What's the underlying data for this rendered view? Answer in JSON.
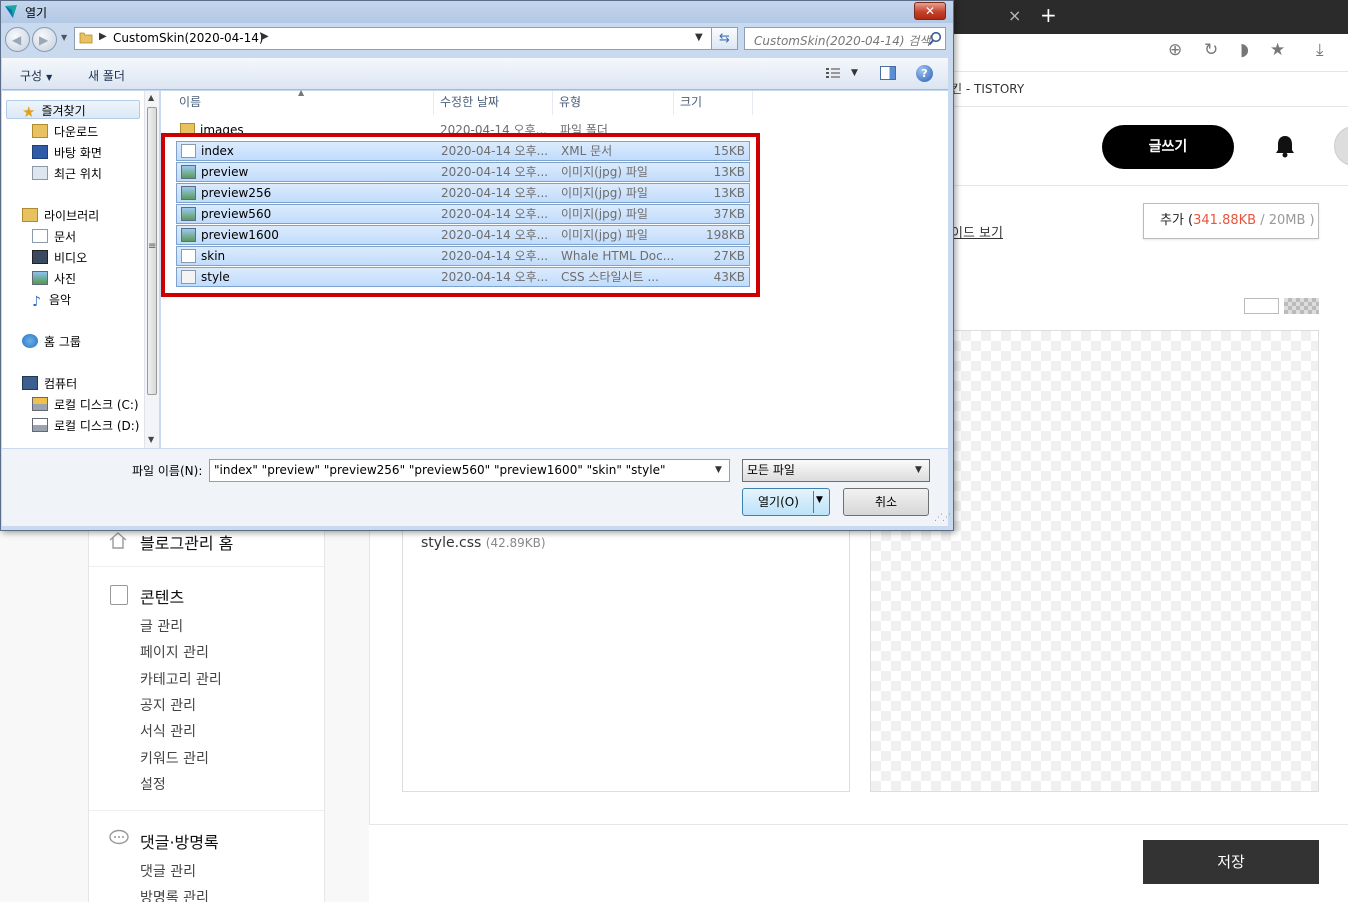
{
  "browser": {
    "tab_close": "×",
    "tab_new": "+",
    "page_title_fragment": "킨 - TISTORY"
  },
  "tistory": {
    "write_button": "글쓰기",
    "guide_link": "이드 보기",
    "storage": {
      "prefix": "추가 (",
      "used": "341.88KB",
      "sep": " / ",
      "total": "20MB",
      "suffix": " )"
    },
    "file_entry": {
      "name": "style.css",
      "size": "(42.89KB)"
    },
    "save_button": "저장",
    "sidebar": {
      "home": "블로그관리 홈",
      "contents_title": "콘텐츠",
      "contents_items": [
        "글 관리",
        "페이지 관리",
        "카테고리 관리",
        "공지 관리",
        "서식 관리",
        "키워드 관리",
        "설정"
      ],
      "comments_title": "댓글·방명록",
      "comments_items": [
        "댓글 관리",
        "방명록 관리"
      ]
    }
  },
  "dialog": {
    "title": "열기",
    "close": "✕",
    "address": "CustomSkin(2020-04-14)",
    "search_placeholder": "CustomSkin(2020-04-14) 검색",
    "commands": {
      "organize": "구성",
      "new_folder": "새 폴더"
    },
    "nav_pane": {
      "favorites": "즐겨찾기",
      "downloads": "다운로드",
      "desktop": "바탕 화면",
      "recent": "최근 위치",
      "libraries": "라이브러리",
      "documents": "문서",
      "videos": "비디오",
      "pictures": "사진",
      "music": "음악",
      "homegroup": "홈 그룹",
      "computer": "컴퓨터",
      "drive_c": "로컬 디스크 (C:)",
      "drive_d": "로컬 디스크 (D:)"
    },
    "columns": {
      "name": "이름",
      "modified": "수정한 날짜",
      "type": "유형",
      "size": "크기"
    },
    "folder": {
      "name": "images",
      "date": "2020-04-14 오후...",
      "type": "파일 폴더"
    },
    "files": [
      {
        "name": "index",
        "date": "2020-04-14 오후...",
        "type": "XML 문서",
        "size": "15KB",
        "icon": "xml-file-icon"
      },
      {
        "name": "preview",
        "date": "2020-04-14 오후...",
        "type": "이미지(jpg) 파일",
        "size": "13KB",
        "icon": "image-file-icon"
      },
      {
        "name": "preview256",
        "date": "2020-04-14 오후...",
        "type": "이미지(jpg) 파일",
        "size": "13KB",
        "icon": "image-file-icon"
      },
      {
        "name": "preview560",
        "date": "2020-04-14 오후...",
        "type": "이미지(jpg) 파일",
        "size": "37KB",
        "icon": "image-file-icon"
      },
      {
        "name": "preview1600",
        "date": "2020-04-14 오후...",
        "type": "이미지(jpg) 파일",
        "size": "198KB",
        "icon": "image-file-icon"
      },
      {
        "name": "skin",
        "date": "2020-04-14 오후...",
        "type": "Whale HTML Doc...",
        "size": "27KB",
        "icon": "html-file-icon"
      },
      {
        "name": "style",
        "date": "2020-04-14 오후...",
        "type": "CSS 스타일시트 ...",
        "size": "43KB",
        "icon": "css-file-icon"
      }
    ],
    "filename_label": "파일 이름(N):",
    "filename_value": "\"index\" \"preview\" \"preview256\" \"preview560\" \"preview1600\" \"skin\" \"style\"",
    "filter_value": "모든 파일",
    "open_button": "열기(O)",
    "cancel_button": "취소",
    "highlight_color": "#cc0000"
  }
}
